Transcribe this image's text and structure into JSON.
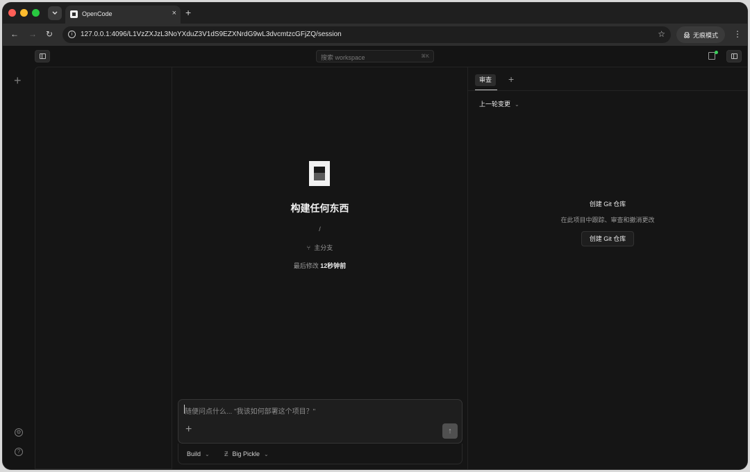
{
  "browser": {
    "tab_title": "OpenCode",
    "url": "127.0.0.1:4096/L1VzZXJzL3NoYXduZ3V1dS9EZXNrdG9wL3dvcmtzcGFjZQ/session",
    "incognito_label": "无痕模式"
  },
  "search": {
    "placeholder": "搜索 workspace",
    "shortcut": "⌘K"
  },
  "main": {
    "title": "构建任何东西",
    "path": "/",
    "branch": "主分支",
    "modified_label": "最后修改",
    "modified_value": "12秒钟前"
  },
  "prompt": {
    "placeholder": "随便问点什么... \"我该如何部署这个项目？\"",
    "agent": "Build",
    "model": "Big Pickle"
  },
  "review": {
    "tab_label": "审查",
    "scope": "上一轮变更",
    "empty_title": "创建 Git 仓库",
    "empty_subtitle": "在此项目中跟踪、审查和撤消更改",
    "create_button": "创建 Git 仓库"
  },
  "colors": {
    "background": "#141414",
    "status_dot": "#3bd15b"
  }
}
